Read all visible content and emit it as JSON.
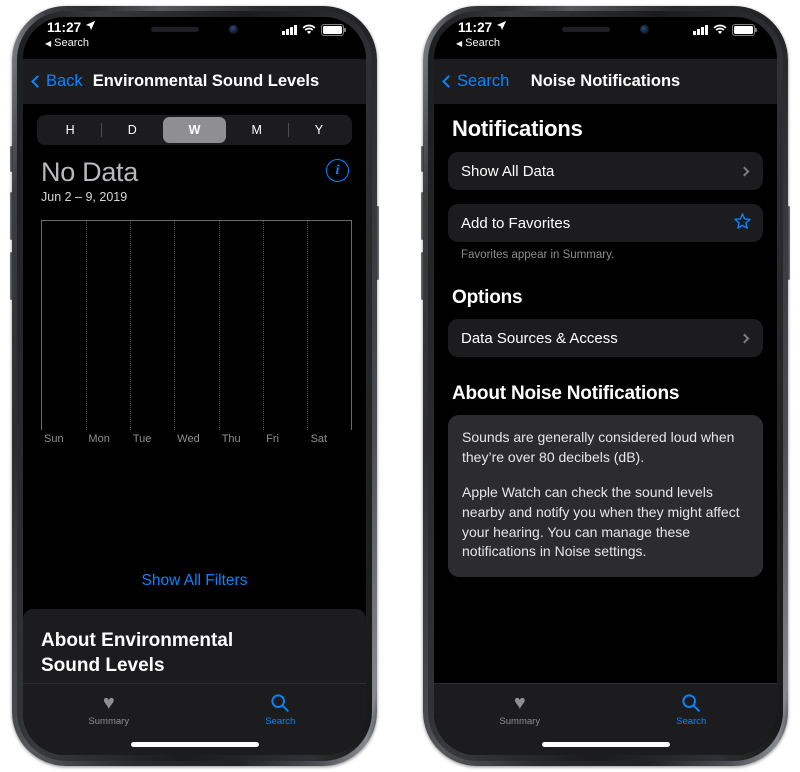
{
  "status_bar": {
    "time": "11:27",
    "location_arrow": "➤",
    "back_indicator": "Search",
    "back_triangle": "◀"
  },
  "left_phone": {
    "nav": {
      "back_label": "Back",
      "title": "Environmental Sound Levels"
    },
    "segments": [
      {
        "label": "H",
        "active": false
      },
      {
        "label": "D",
        "active": false
      },
      {
        "label": "W",
        "active": true
      },
      {
        "label": "M",
        "active": false
      },
      {
        "label": "Y",
        "active": false
      }
    ],
    "chart_header": {
      "value": "No Data",
      "date_range": "Jun 2 – 9, 2019",
      "info_icon": "i"
    },
    "filters_link": "Show All Filters",
    "about": {
      "title": "About Environmental\nSound Levels",
      "line1": "About Environmental",
      "line2": "Sound Levels"
    }
  },
  "right_phone": {
    "nav": {
      "back_label": "Search",
      "title": "Noise Notifications"
    },
    "sections": [
      {
        "title": "Notifications",
        "rows": [
          {
            "label": "Show All Data",
            "accessory": "chevron-right"
          },
          {
            "label": "Add to Favorites",
            "accessory": "star"
          }
        ],
        "footnote": "Favorites appear in Summary."
      },
      {
        "title": "Options",
        "rows": [
          {
            "label": "Data Sources & Access",
            "accessory": "chevron-right"
          }
        ]
      }
    ],
    "about": {
      "title": "About Noise Notifications",
      "paragraphs": [
        "Sounds are generally considered loud when they’re over 80 decibels (dB).",
        "Apple Watch can check the sound levels nearby and notify you when they might affect your hearing. You can manage these notifications in Noise settings."
      ]
    }
  },
  "tabbar": {
    "tabs": [
      {
        "label": "Summary",
        "icon": "heart-icon",
        "active": false
      },
      {
        "label": "Search",
        "icon": "search-icon",
        "active": true
      }
    ]
  },
  "colors": {
    "accent_blue": "#0a84ff",
    "screen_bg": "#000000",
    "card_bg": "#1c1c1e",
    "text_card_bg": "#2c2c2e",
    "secondary_text": "#8e8e93",
    "segment_active": "#8e8e93"
  },
  "chart_data": {
    "type": "bar",
    "title": "No Data",
    "subtitle": "Jun 2 – 9, 2019",
    "categories": [
      "Sun",
      "Mon",
      "Tue",
      "Wed",
      "Thu",
      "Fri",
      "Sat"
    ],
    "values": [
      null,
      null,
      null,
      null,
      null,
      null,
      null
    ],
    "xlabel": "",
    "ylabel": "",
    "grid": true,
    "legend": "none",
    "range_selector": "W",
    "empty_state": "No Data"
  }
}
